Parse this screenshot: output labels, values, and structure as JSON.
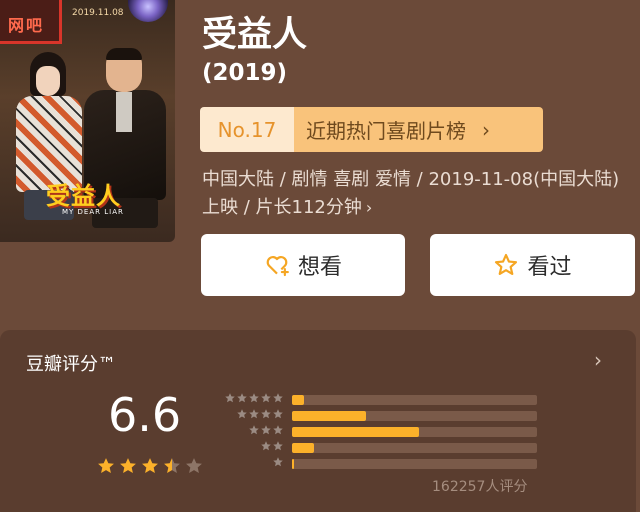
{
  "movie": {
    "title": "受益人",
    "year": "(2019)",
    "rank_no": "No.17",
    "rank_list": "近期热门喜剧片榜",
    "meta_line": "中国大陆 / 剧情 喜剧 爱情 / 2019-11-08(中国大陆)上映 / 片长112分钟"
  },
  "poster": {
    "neon_text": "网吧",
    "date_text": "2019.11.08",
    "title_text": "受益人",
    "subtitle_text": "MY DEAR LIAR"
  },
  "actions": {
    "want_label": "想看",
    "seen_label": "看过"
  },
  "rating": {
    "label": "豆瓣评分™",
    "score": "6.6",
    "avg_stars": 3.5,
    "distribution_percent": [
      5,
      30,
      52,
      9,
      1
    ],
    "count_text": "162257人评分"
  },
  "colors": {
    "background": "#6b4a39",
    "card": "#5a3d2f",
    "accent": "#fcb12a",
    "rank_badge": "#f9c37b",
    "rank_no_bg": "#fde9cf"
  },
  "icons": {
    "want": "heart-plus-icon",
    "seen": "star-outline-icon",
    "chevron": "chevron-right-icon"
  }
}
